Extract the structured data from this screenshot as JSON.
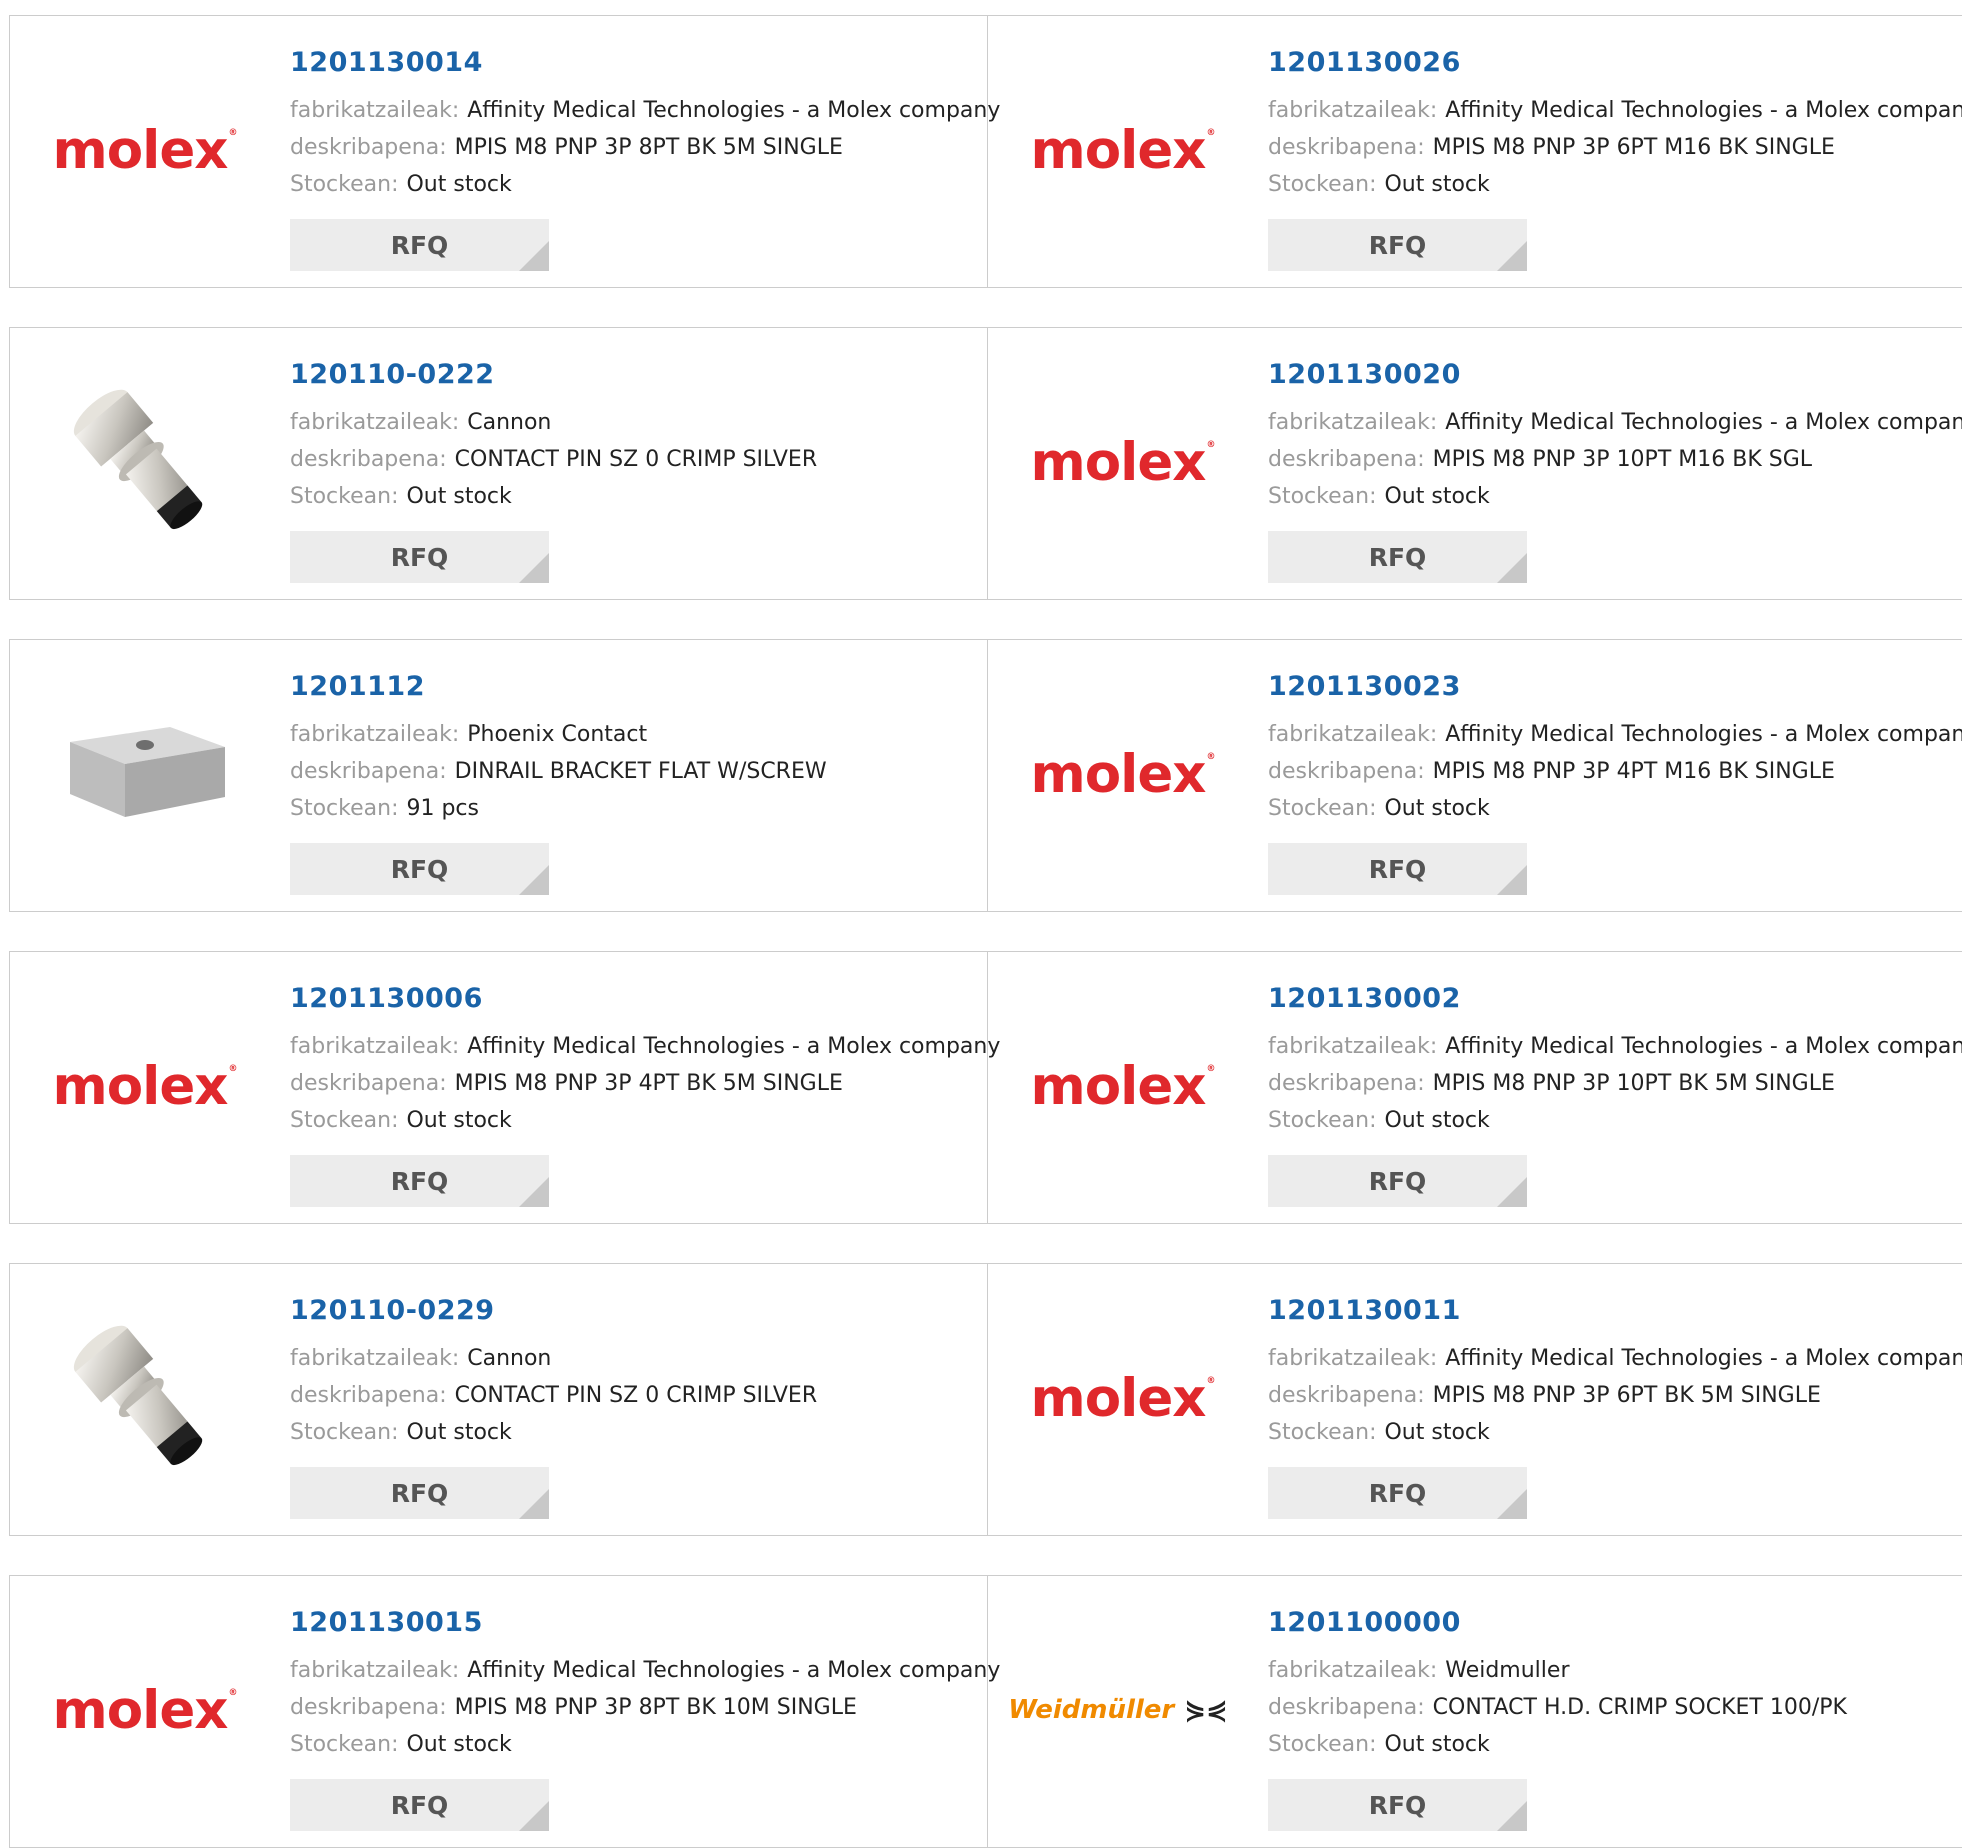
{
  "labels": {
    "manufacturer": "fabrikatzaileak:",
    "description": "deskribapena:",
    "stock": "Stockean:",
    "rfq": "RFQ"
  },
  "colors": {
    "part_number": "#1a63a8",
    "label_gray": "#9a9a9a",
    "molex_red": "#e0282c",
    "weidmuller_orange": "#f08a00"
  },
  "products": [
    {
      "part_number": "1201130014",
      "manufacturer": "Affinity Medical Technologies - a Molex company",
      "description": "MPIS M8 PNP 3P 8PT BK 5M SINGLE",
      "stock": "Out stock",
      "image": "molex-logo"
    },
    {
      "part_number": "1201130026",
      "manufacturer": "Affinity Medical Technologies - a Molex company",
      "description": "MPIS M8 PNP 3P 6PT M16 BK SINGLE",
      "stock": "Out stock",
      "image": "molex-logo"
    },
    {
      "part_number": "120110-0222",
      "manufacturer": "Cannon",
      "description": "CONTACT PIN SZ 0 CRIMP SILVER",
      "stock": "Out stock",
      "image": "contact-pin-photo"
    },
    {
      "part_number": "1201130020",
      "manufacturer": "Affinity Medical Technologies - a Molex company",
      "description": "MPIS M8 PNP 3P 10PT M16 BK SGL",
      "stock": "Out stock",
      "image": "molex-logo"
    },
    {
      "part_number": "1201112",
      "manufacturer": "Phoenix Contact",
      "description": "DINRAIL BRACKET FLAT W/SCREW",
      "stock": "91 pcs",
      "image": "bracket-photo"
    },
    {
      "part_number": "1201130023",
      "manufacturer": "Affinity Medical Technologies - a Molex company",
      "description": "MPIS M8 PNP 3P 4PT M16 BK SINGLE",
      "stock": "Out stock",
      "image": "molex-logo"
    },
    {
      "part_number": "1201130006",
      "manufacturer": "Affinity Medical Technologies - a Molex company",
      "description": "MPIS M8 PNP 3P 4PT BK 5M SINGLE",
      "stock": "Out stock",
      "image": "molex-logo"
    },
    {
      "part_number": "1201130002",
      "manufacturer": "Affinity Medical Technologies - a Molex company",
      "description": "MPIS M8 PNP 3P 10PT BK 5M SINGLE",
      "stock": "Out stock",
      "image": "molex-logo"
    },
    {
      "part_number": "120110-0229",
      "manufacturer": "Cannon",
      "description": "CONTACT PIN SZ 0 CRIMP SILVER",
      "stock": "Out stock",
      "image": "contact-pin-photo"
    },
    {
      "part_number": "1201130011",
      "manufacturer": "Affinity Medical Technologies - a Molex company",
      "description": "MPIS M8 PNP 3P 6PT BK 5M SINGLE",
      "stock": "Out stock",
      "image": "molex-logo"
    },
    {
      "part_number": "1201130015",
      "manufacturer": "Affinity Medical Technologies - a Molex company",
      "description": "MPIS M8 PNP 3P 8PT BK 10M SINGLE",
      "stock": "Out stock",
      "image": "molex-logo"
    },
    {
      "part_number": "1201100000",
      "manufacturer": "Weidmuller",
      "description": "CONTACT H.D. CRIMP SOCKET 100/PK",
      "stock": "Out stock",
      "image": "weidmuller-logo"
    }
  ],
  "logos": {
    "molex": "molex",
    "weidmuller": "Weidmüller"
  }
}
